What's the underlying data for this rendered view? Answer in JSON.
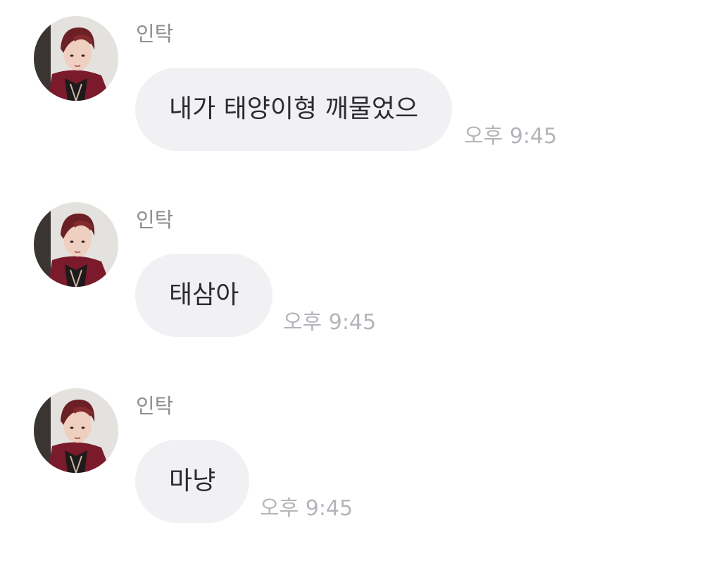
{
  "messages": [
    {
      "sender": "인탁",
      "text": "내가 태양이형 깨물었으",
      "time": "오후 9:45"
    },
    {
      "sender": "인탁",
      "text": "태삼아",
      "time": "오후 9:45"
    },
    {
      "sender": "인탁",
      "text": "마냥",
      "time": "오후 9:45"
    }
  ],
  "colors": {
    "background": "#ffffff",
    "bubble": "#f1f1f4",
    "message_text": "#2b2b33",
    "sender_text": "#8e8e93",
    "time_text": "#b4b4ba"
  },
  "icons": {
    "avatar": "profile-photo"
  }
}
